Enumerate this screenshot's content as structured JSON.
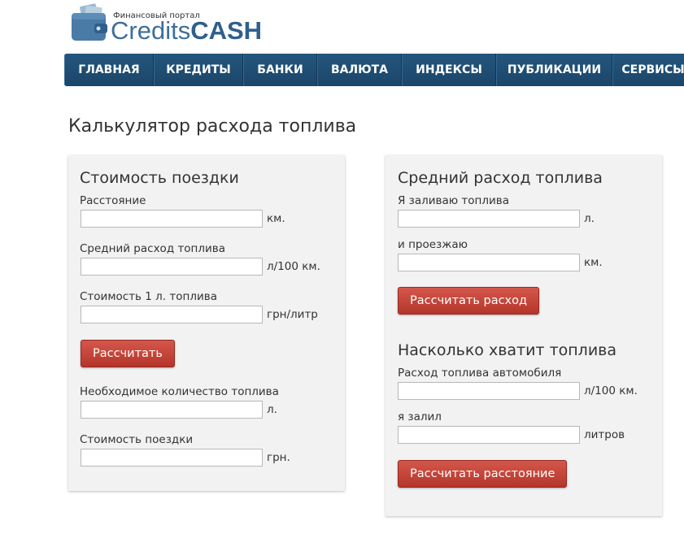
{
  "logo": {
    "tagline": "Финансовый портал",
    "word_part1": "Credits",
    "word_part2": "CASH"
  },
  "nav": {
    "items": [
      {
        "label": "ГЛАВНАЯ"
      },
      {
        "label": "КРЕДИТЫ"
      },
      {
        "label": "БАНКИ"
      },
      {
        "label": "ВАЛЮТА"
      },
      {
        "label": "ИНДЕКСЫ"
      },
      {
        "label": "ПУБЛИКАЦИИ"
      },
      {
        "label": "СЕРВИСЫ"
      }
    ]
  },
  "page": {
    "title": "Калькулятор расхода топлива"
  },
  "trip_cost": {
    "title": "Стоимость поездки",
    "distance": {
      "label": "Расстояние",
      "value": "",
      "unit": "км."
    },
    "consumption": {
      "label": "Средний расход топлива",
      "value": "",
      "unit": "л/100 км."
    },
    "fuel_price": {
      "label": "Стоимость 1 л. топлива",
      "value": "",
      "unit": "грн/литр"
    },
    "calculate_button": "Рассчитать",
    "required_fuel": {
      "label": "Необходимое количество топлива",
      "value": "",
      "unit": "л."
    },
    "trip_total": {
      "label": "Стоимость поездки",
      "value": "",
      "unit": "грн."
    }
  },
  "avg_consumption": {
    "title": "Средний расход топлива",
    "fuel_poured": {
      "label": "Я заливаю топлива",
      "value": "",
      "unit": "л."
    },
    "distance_driven": {
      "label": "и проезжаю",
      "value": "",
      "unit": "км."
    },
    "calculate_button": "Рассчитать расход"
  },
  "range": {
    "title": "Насколько хватит топлива",
    "car_consumption": {
      "label": "Расход топлива автомобиля",
      "value": "",
      "unit": "л/100 км."
    },
    "fuel_filled": {
      "label": "я залил",
      "value": "",
      "unit": "литров"
    },
    "calculate_button": "Рассчитать расстояние"
  },
  "colors": {
    "nav_bg": "#1f4e75",
    "button_red": "#c0443a",
    "logo_blue": "#3d6f9a",
    "panel_bg": "#f2f2f2"
  }
}
